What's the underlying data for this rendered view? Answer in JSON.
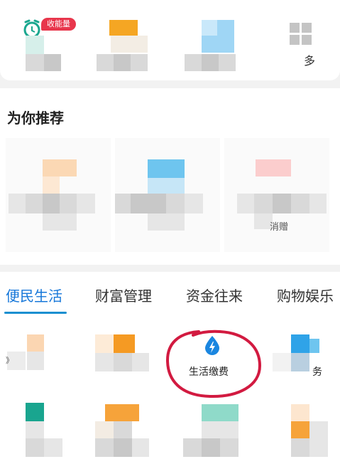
{
  "badge": {
    "label": "收能量"
  },
  "more_partial_label": "多",
  "recommend": {
    "title": "为你推荐",
    "gift_partial_label": "消赠"
  },
  "tabs": [
    {
      "label": "便民生活",
      "active": true
    },
    {
      "label": "财富管理",
      "active": false
    },
    {
      "label": "资金往来",
      "active": false
    },
    {
      "label": "购物娱乐",
      "active": false
    }
  ],
  "services": {
    "utility_label": "生活缴费",
    "partial_right_label": "务",
    "partial_left_label": "》"
  },
  "colors": {
    "accent": "#1677d9",
    "badge": "#e8364c",
    "annotation": "#d21a40",
    "utility_icon": "#1a86e0"
  },
  "icons": {
    "utility": "water-drop-lightning-icon",
    "more": "grid-icon"
  }
}
